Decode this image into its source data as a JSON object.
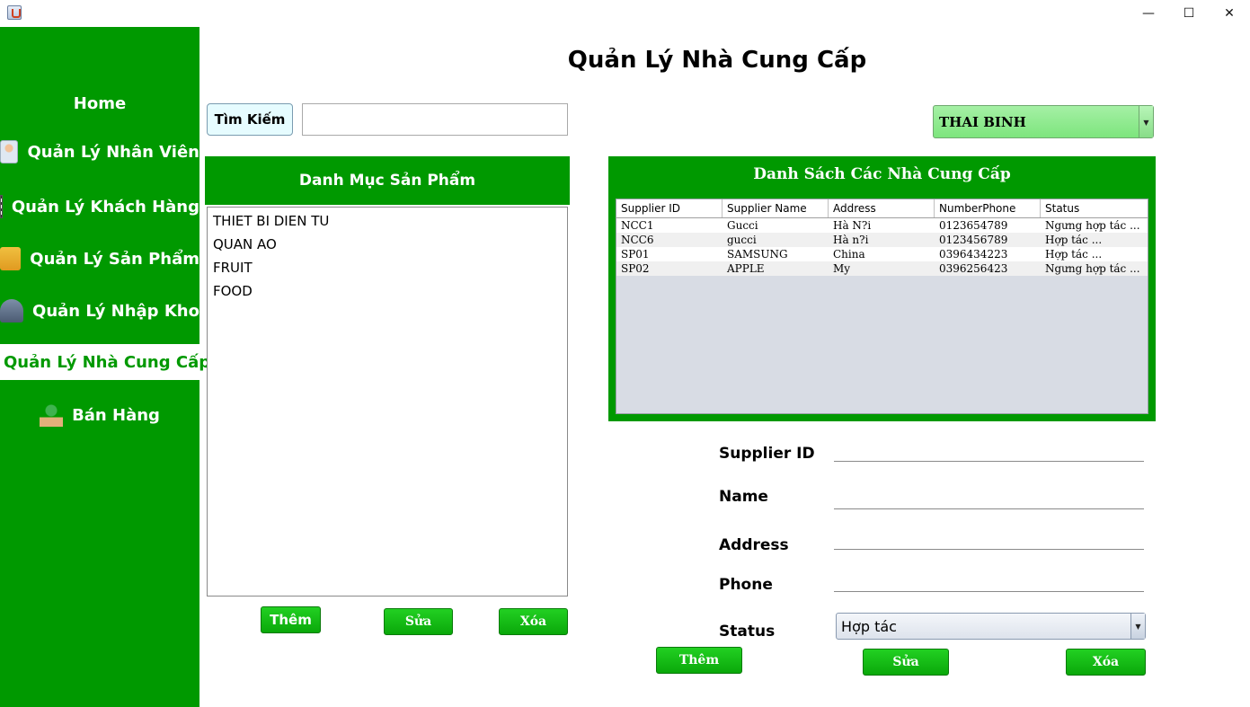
{
  "window": {
    "minimize_glyph": "—",
    "maximize_glyph": "☐",
    "close_glyph": "✕"
  },
  "sidebar": {
    "items": [
      {
        "label": "Home",
        "icon": "home"
      },
      {
        "label": "Quản Lý Nhân Viên",
        "icon": "staff-icon"
      },
      {
        "label": "Quản Lý Khách Hàng",
        "icon": "customer-icon"
      },
      {
        "label": "Quản Lý Sản Phẩm",
        "icon": "product-icon"
      },
      {
        "label": "Quản Lý Nhập Kho",
        "icon": "warehouse-icon"
      },
      {
        "label": "Quản Lý Nhà Cung Cấp",
        "icon": "supplier-icon",
        "active": true
      },
      {
        "label": "Bán Hàng",
        "icon": "sales-icon"
      }
    ]
  },
  "page": {
    "title": "Quản Lý Nhà Cung Cấp"
  },
  "search": {
    "button_label": "Tìm Kiếm",
    "value": ""
  },
  "category": {
    "header": "Danh Mục Sản Phẩm",
    "items": [
      "THIET BI DIEN TU",
      "QUAN AO",
      "FRUIT",
      "FOOD"
    ],
    "add_label": "Thêm",
    "edit_label": "Sửa",
    "delete_label": "Xóa"
  },
  "branch": {
    "selected": "THAI BINH"
  },
  "supplier_table": {
    "title": "Danh Sách Các Nhà Cung Cấp",
    "columns": [
      "Supplier ID",
      "Supplier Name",
      "Address",
      "NumberPhone",
      "Status"
    ],
    "rows": [
      [
        "NCC1",
        "Gucci",
        "Hà N?i",
        "0123654789",
        "Ngưng hợp tác    ..."
      ],
      [
        "NCC6",
        "gucci",
        "Hà n?i",
        "0123456789",
        "Hợp tác             ..."
      ],
      [
        "SP01",
        "SAMSUNG",
        "China",
        "0396434223",
        "Hợp tác             ..."
      ],
      [
        "SP02",
        "APPLE",
        "My",
        "0396256423",
        "Ngưng hợp tác    ..."
      ]
    ]
  },
  "form": {
    "supplier_id_label": "Supplier ID",
    "name_label": "Name",
    "address_label": "Address",
    "phone_label": "Phone",
    "status_label": "Status",
    "status_selected": "Hợp tác",
    "add_label": "Thêm",
    "edit_label": "Sửa",
    "delete_label": "Xóa"
  },
  "colors": {
    "sidebar_green": "#009900",
    "button_green": "#12bb12",
    "combo_green": "#90ee90"
  }
}
